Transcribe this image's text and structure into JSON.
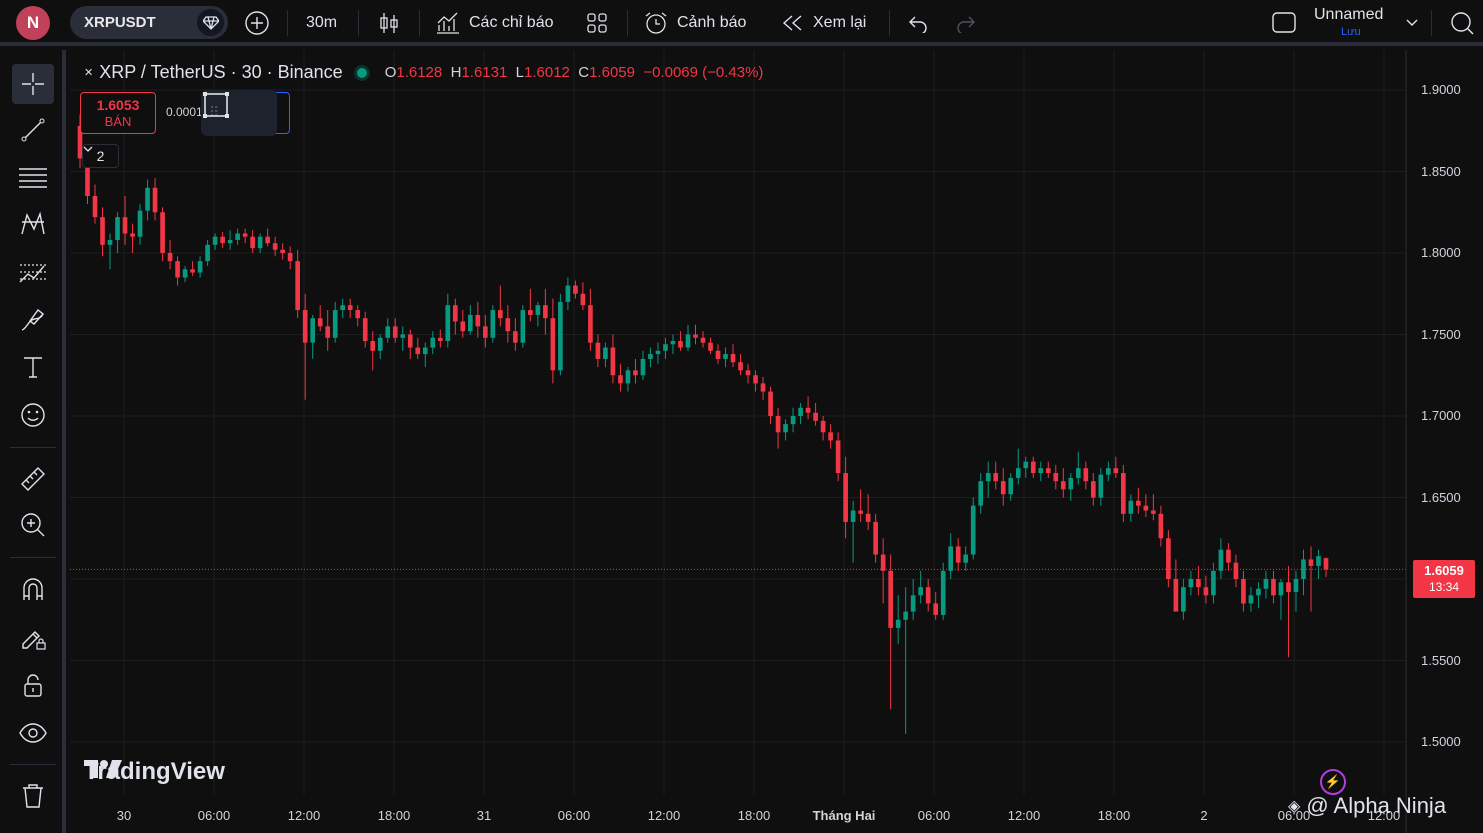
{
  "topbar": {
    "avatar_letter": "N",
    "symbol": "XRPUSDT",
    "interval": "30m",
    "indicators_label": "Các chỉ báo",
    "alerts_label": "Cảnh báo",
    "replay_label": "Xem lại",
    "layout_name": "Unnamed",
    "save_label": "Lưu"
  },
  "legend": {
    "title": "XRP / TetherUS · 30 · Binance",
    "o_label": "O",
    "o": "1.6128",
    "h_label": "H",
    "h": "1.6131",
    "l_label": "L",
    "l": "1.6012",
    "c_label": "C",
    "c": "1.6059",
    "change": "−0.0069 (−0.43%)",
    "collapse_count": "2"
  },
  "trade": {
    "sell_price": "1.6053",
    "sell_label": "BÁN",
    "spread": "0.0001"
  },
  "price_tag": {
    "price": "1.6059",
    "countdown": "13:34"
  },
  "y_axis": [
    "1.9000",
    "1.8500",
    "1.8000",
    "1.7500",
    "1.7000",
    "1.6500",
    "1.6000",
    "1.5500",
    "1.5000"
  ],
  "x_axis": [
    "30",
    "06:00",
    "12:00",
    "18:00",
    "31",
    "06:00",
    "12:00",
    "18:00",
    "Tháng Hai",
    "06:00",
    "12:00",
    "18:00",
    "2",
    "06:00",
    "12:00"
  ],
  "branding": {
    "logo_text": "TradingView",
    "watermark": "@ Alpha Ninja"
  },
  "colors": {
    "up": "#089981",
    "down": "#f23645",
    "background": "#0f0f0f",
    "grid": "#1e1e1e",
    "accent": "#2962ff"
  },
  "icons": [
    "crosshair-icon",
    "trendline-icon",
    "fib-icon",
    "pattern-icon",
    "forecast-icon",
    "brush-icon",
    "text-icon",
    "emoji-icon",
    "ruler-icon",
    "zoom-icon",
    "magnet-icon",
    "lock-drawing-icon",
    "lock-icon",
    "eye-icon",
    "trash-icon"
  ],
  "chart_data": {
    "type": "candlestick",
    "interval": "30",
    "ylim": [
      1.48,
      1.915
    ],
    "x_tick_labels": [
      "30",
      "06:00",
      "12:00",
      "18:00",
      "31",
      "06:00",
      "12:00",
      "18:00",
      "Tháng Hai",
      "06:00",
      "12:00",
      "18:00",
      "2",
      "06:00",
      "12:00"
    ],
    "series": [
      {
        "name": "XRP / TetherUS",
        "ohlc": [
          [
            1.878,
            1.885,
            1.852,
            1.858
          ],
          [
            1.858,
            1.862,
            1.83,
            1.835
          ],
          [
            1.835,
            1.842,
            1.818,
            1.822
          ],
          [
            1.822,
            1.828,
            1.798,
            1.805
          ],
          [
            1.805,
            1.812,
            1.79,
            1.808
          ],
          [
            1.808,
            1.825,
            1.8,
            1.822
          ],
          [
            1.822,
            1.835,
            1.805,
            1.812
          ],
          [
            1.812,
            1.818,
            1.8,
            1.81
          ],
          [
            1.81,
            1.83,
            1.805,
            1.826
          ],
          [
            1.826,
            1.845,
            1.82,
            1.84
          ],
          [
            1.84,
            1.846,
            1.82,
            1.825
          ],
          [
            1.825,
            1.828,
            1.795,
            1.8
          ],
          [
            1.8,
            1.808,
            1.79,
            1.795
          ],
          [
            1.795,
            1.798,
            1.78,
            1.785
          ],
          [
            1.785,
            1.792,
            1.782,
            1.79
          ],
          [
            1.79,
            1.795,
            1.786,
            1.788
          ],
          [
            1.788,
            1.798,
            1.785,
            1.795
          ],
          [
            1.795,
            1.808,
            1.792,
            1.805
          ],
          [
            1.805,
            1.812,
            1.802,
            1.81
          ],
          [
            1.81,
            1.813,
            1.803,
            1.806
          ],
          [
            1.806,
            1.814,
            1.802,
            1.808
          ],
          [
            1.808,
            1.815,
            1.805,
            1.812
          ],
          [
            1.812,
            1.815,
            1.806,
            1.81
          ],
          [
            1.81,
            1.814,
            1.8,
            1.803
          ],
          [
            1.803,
            1.812,
            1.8,
            1.81
          ],
          [
            1.81,
            1.815,
            1.804,
            1.806
          ],
          [
            1.806,
            1.81,
            1.798,
            1.802
          ],
          [
            1.802,
            1.806,
            1.796,
            1.8
          ],
          [
            1.8,
            1.804,
            1.79,
            1.795
          ],
          [
            1.795,
            1.802,
            1.76,
            1.765
          ],
          [
            1.765,
            1.775,
            1.71,
            1.745
          ],
          [
            1.745,
            1.762,
            1.735,
            1.76
          ],
          [
            1.76,
            1.768,
            1.752,
            1.755
          ],
          [
            1.755,
            1.765,
            1.74,
            1.748
          ],
          [
            1.748,
            1.77,
            1.745,
            1.765
          ],
          [
            1.765,
            1.772,
            1.76,
            1.768
          ],
          [
            1.768,
            1.772,
            1.76,
            1.765
          ],
          [
            1.765,
            1.768,
            1.755,
            1.76
          ],
          [
            1.76,
            1.764,
            1.742,
            1.746
          ],
          [
            1.746,
            1.752,
            1.728,
            1.74
          ],
          [
            1.74,
            1.75,
            1.735,
            1.748
          ],
          [
            1.748,
            1.76,
            1.745,
            1.755
          ],
          [
            1.755,
            1.76,
            1.745,
            1.748
          ],
          [
            1.748,
            1.755,
            1.74,
            1.75
          ],
          [
            1.75,
            1.753,
            1.735,
            1.742
          ],
          [
            1.742,
            1.748,
            1.735,
            1.738
          ],
          [
            1.738,
            1.745,
            1.73,
            1.742
          ],
          [
            1.742,
            1.752,
            1.738,
            1.748
          ],
          [
            1.748,
            1.753,
            1.742,
            1.746
          ],
          [
            1.746,
            1.775,
            1.742,
            1.768
          ],
          [
            1.768,
            1.772,
            1.75,
            1.758
          ],
          [
            1.758,
            1.765,
            1.748,
            1.752
          ],
          [
            1.752,
            1.768,
            1.75,
            1.762
          ],
          [
            1.762,
            1.77,
            1.748,
            1.755
          ],
          [
            1.755,
            1.762,
            1.742,
            1.748
          ],
          [
            1.748,
            1.768,
            1.745,
            1.765
          ],
          [
            1.765,
            1.78,
            1.755,
            1.76
          ],
          [
            1.76,
            1.768,
            1.745,
            1.752
          ],
          [
            1.752,
            1.76,
            1.74,
            1.745
          ],
          [
            1.745,
            1.768,
            1.742,
            1.765
          ],
          [
            1.765,
            1.778,
            1.758,
            1.762
          ],
          [
            1.762,
            1.77,
            1.755,
            1.768
          ],
          [
            1.768,
            1.778,
            1.75,
            1.76
          ],
          [
            1.76,
            1.772,
            1.72,
            1.728
          ],
          [
            1.728,
            1.775,
            1.725,
            1.77
          ],
          [
            1.77,
            1.785,
            1.765,
            1.78
          ],
          [
            1.78,
            1.783,
            1.772,
            1.775
          ],
          [
            1.775,
            1.782,
            1.765,
            1.768
          ],
          [
            1.768,
            1.778,
            1.74,
            1.745
          ],
          [
            1.745,
            1.75,
            1.73,
            1.735
          ],
          [
            1.735,
            1.745,
            1.73,
            1.742
          ],
          [
            1.742,
            1.75,
            1.72,
            1.725
          ],
          [
            1.725,
            1.732,
            1.715,
            1.72
          ],
          [
            1.72,
            1.73,
            1.715,
            1.728
          ],
          [
            1.728,
            1.735,
            1.72,
            1.725
          ],
          [
            1.725,
            1.74,
            1.722,
            1.735
          ],
          [
            1.735,
            1.742,
            1.73,
            1.738
          ],
          [
            1.738,
            1.745,
            1.732,
            1.74
          ],
          [
            1.74,
            1.748,
            1.735,
            1.744
          ],
          [
            1.744,
            1.75,
            1.738,
            1.746
          ],
          [
            1.746,
            1.752,
            1.74,
            1.742
          ],
          [
            1.742,
            1.756,
            1.74,
            1.75
          ],
          [
            1.75,
            1.756,
            1.744,
            1.748
          ],
          [
            1.748,
            1.752,
            1.742,
            1.745
          ],
          [
            1.745,
            1.748,
            1.738,
            1.74
          ],
          [
            1.74,
            1.744,
            1.732,
            1.735
          ],
          [
            1.735,
            1.742,
            1.73,
            1.738
          ],
          [
            1.738,
            1.744,
            1.73,
            1.733
          ],
          [
            1.733,
            1.738,
            1.725,
            1.728
          ],
          [
            1.728,
            1.732,
            1.72,
            1.725
          ],
          [
            1.725,
            1.728,
            1.715,
            1.72
          ],
          [
            1.72,
            1.724,
            1.71,
            1.715
          ],
          [
            1.715,
            1.718,
            1.695,
            1.7
          ],
          [
            1.7,
            1.705,
            1.68,
            1.69
          ],
          [
            1.69,
            1.698,
            1.685,
            1.695
          ],
          [
            1.695,
            1.705,
            1.69,
            1.7
          ],
          [
            1.7,
            1.708,
            1.695,
            1.705
          ],
          [
            1.705,
            1.712,
            1.698,
            1.702
          ],
          [
            1.702,
            1.708,
            1.694,
            1.697
          ],
          [
            1.697,
            1.7,
            1.685,
            1.69
          ],
          [
            1.69,
            1.695,
            1.68,
            1.685
          ],
          [
            1.685,
            1.69,
            1.66,
            1.665
          ],
          [
            1.665,
            1.675,
            1.625,
            1.635
          ],
          [
            1.635,
            1.648,
            1.61,
            1.642
          ],
          [
            1.642,
            1.655,
            1.635,
            1.64
          ],
          [
            1.64,
            1.652,
            1.63,
            1.635
          ],
          [
            1.635,
            1.64,
            1.61,
            1.615
          ],
          [
            1.615,
            1.625,
            1.585,
            1.605
          ],
          [
            1.605,
            1.615,
            1.52,
            1.57
          ],
          [
            1.57,
            1.59,
            1.56,
            1.575
          ],
          [
            1.575,
            1.595,
            1.505,
            1.58
          ],
          [
            1.58,
            1.6,
            1.575,
            1.59
          ],
          [
            1.59,
            1.605,
            1.585,
            1.595
          ],
          [
            1.595,
            1.6,
            1.58,
            1.585
          ],
          [
            1.585,
            1.592,
            1.575,
            1.578
          ],
          [
            1.578,
            1.61,
            1.575,
            1.605
          ],
          [
            1.605,
            1.628,
            1.6,
            1.62
          ],
          [
            1.62,
            1.625,
            1.605,
            1.61
          ],
          [
            1.61,
            1.62,
            1.605,
            1.615
          ],
          [
            1.615,
            1.65,
            1.612,
            1.645
          ],
          [
            1.645,
            1.665,
            1.64,
            1.66
          ],
          [
            1.66,
            1.672,
            1.65,
            1.665
          ],
          [
            1.665,
            1.672,
            1.655,
            1.66
          ],
          [
            1.66,
            1.668,
            1.645,
            1.652
          ],
          [
            1.652,
            1.665,
            1.648,
            1.662
          ],
          [
            1.662,
            1.68,
            1.658,
            1.668
          ],
          [
            1.668,
            1.675,
            1.662,
            1.672
          ],
          [
            1.672,
            1.675,
            1.662,
            1.665
          ],
          [
            1.665,
            1.672,
            1.66,
            1.668
          ],
          [
            1.668,
            1.672,
            1.662,
            1.665
          ],
          [
            1.665,
            1.67,
            1.655,
            1.66
          ],
          [
            1.66,
            1.668,
            1.65,
            1.655
          ],
          [
            1.655,
            1.665,
            1.648,
            1.662
          ],
          [
            1.662,
            1.678,
            1.658,
            1.668
          ],
          [
            1.668,
            1.672,
            1.655,
            1.66
          ],
          [
            1.66,
            1.665,
            1.645,
            1.65
          ],
          [
            1.65,
            1.668,
            1.645,
            1.664
          ],
          [
            1.664,
            1.672,
            1.66,
            1.668
          ],
          [
            1.668,
            1.675,
            1.662,
            1.665
          ],
          [
            1.665,
            1.67,
            1.635,
            1.64
          ],
          [
            1.64,
            1.652,
            1.635,
            1.648
          ],
          [
            1.648,
            1.656,
            1.64,
            1.645
          ],
          [
            1.645,
            1.652,
            1.638,
            1.642
          ],
          [
            1.642,
            1.652,
            1.636,
            1.64
          ],
          [
            1.64,
            1.645,
            1.62,
            1.625
          ],
          [
            1.625,
            1.63,
            1.595,
            1.6
          ],
          [
            1.6,
            1.612,
            1.585,
            1.58
          ],
          [
            1.58,
            1.6,
            1.575,
            1.595
          ],
          [
            1.595,
            1.605,
            1.59,
            1.6
          ],
          [
            1.6,
            1.608,
            1.59,
            1.595
          ],
          [
            1.595,
            1.602,
            1.585,
            1.59
          ],
          [
            1.59,
            1.61,
            1.585,
            1.605
          ],
          [
            1.605,
            1.625,
            1.6,
            1.618
          ],
          [
            1.618,
            1.622,
            1.605,
            1.61
          ],
          [
            1.61,
            1.615,
            1.595,
            1.6
          ],
          [
            1.6,
            1.605,
            1.58,
            1.585
          ],
          [
            1.585,
            1.595,
            1.58,
            1.59
          ],
          [
            1.59,
            1.598,
            1.582,
            1.594
          ],
          [
            1.594,
            1.605,
            1.588,
            1.6
          ],
          [
            1.6,
            1.605,
            1.585,
            1.59
          ],
          [
            1.59,
            1.6,
            1.575,
            1.598
          ],
          [
            1.598,
            1.608,
            1.552,
            1.592
          ],
          [
            1.592,
            1.605,
            1.58,
            1.6
          ],
          [
            1.6,
            1.618,
            1.59,
            1.612
          ],
          [
            1.612,
            1.62,
            1.58,
            1.608
          ],
          [
            1.608,
            1.618,
            1.6,
            1.614
          ],
          [
            1.6128,
            1.6131,
            1.6012,
            1.6059
          ]
        ]
      }
    ],
    "last_price": 1.6059
  }
}
